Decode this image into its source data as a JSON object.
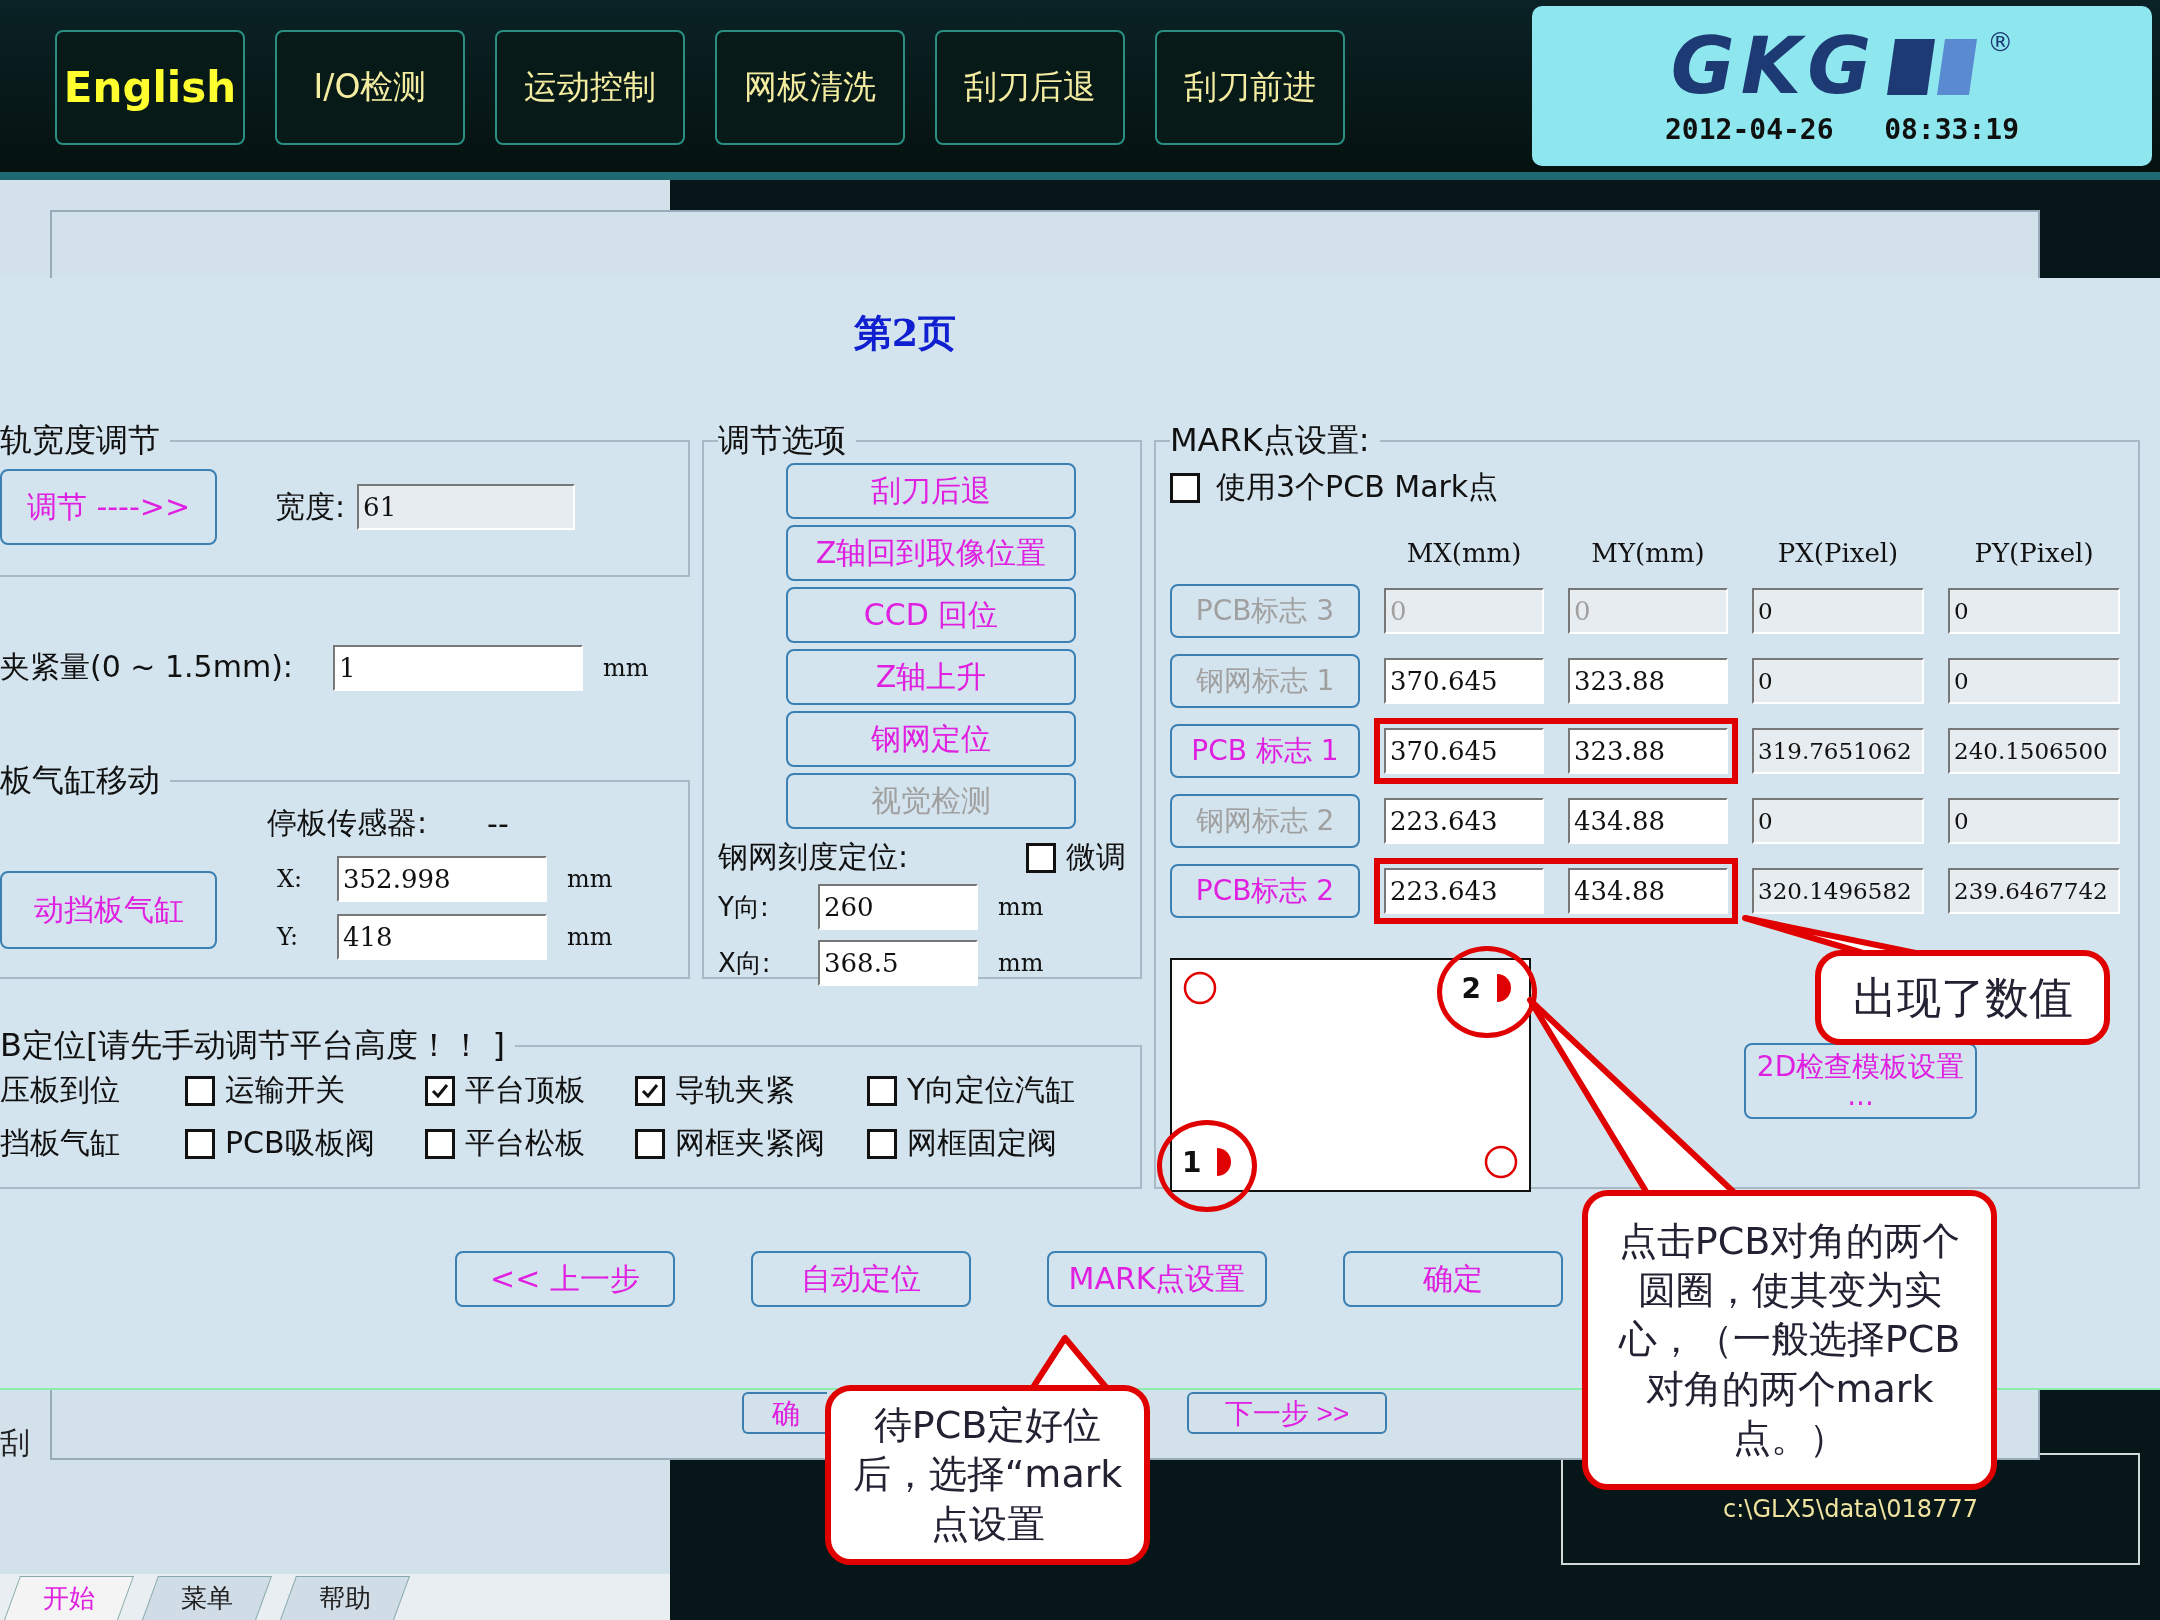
{
  "top_bar": {
    "buttons": [
      {
        "label": "English",
        "kind": "language"
      },
      {
        "label": "I/O检测",
        "kind": "nav"
      },
      {
        "label": "运动控制",
        "kind": "nav"
      },
      {
        "label": "网板清洗",
        "kind": "nav"
      },
      {
        "label": "刮刀后退",
        "kind": "nav"
      },
      {
        "label": "刮刀前进",
        "kind": "nav"
      }
    ]
  },
  "logo": {
    "text": "GKG",
    "registered": "®",
    "datetime": "2012-04-26   08:33:19"
  },
  "background_window": {
    "buttons": [
      "确",
      "下一步 >>"
    ]
  },
  "left_panel": {
    "text": "刮",
    "tabs": [
      {
        "label": "开始",
        "selected": true
      },
      {
        "label": "菜单",
        "selected": false
      },
      {
        "label": "帮助",
        "selected": false
      }
    ]
  },
  "status_path": "c:\\GLX5\\data\\018777",
  "dialog": {
    "title": "第2页",
    "rail_width": {
      "legend": "轨宽度调节",
      "button": "调节 ---->>",
      "width_label": "宽度:",
      "width_value": "61"
    },
    "clamp": {
      "label": "夹紧量(0 ~ 1.5mm):",
      "value": "1",
      "unit": "mm"
    },
    "cylinder": {
      "legend": "板气缸移动",
      "button": "动挡板气缸",
      "sensor_label": "停板传感器:",
      "sensor_value": "--",
      "fields": [
        {
          "label": "X:",
          "value": "352.998",
          "unit": "mm"
        },
        {
          "label": "Y:",
          "value": "418",
          "unit": "mm"
        }
      ]
    },
    "options": {
      "legend": "调节选项",
      "buttons": [
        {
          "label": "刮刀后退",
          "disabled": false
        },
        {
          "label": "Z轴回到取像位置",
          "disabled": false
        },
        {
          "label": "CCD 回位",
          "disabled": false
        },
        {
          "label": "Z轴上升",
          "disabled": false
        },
        {
          "label": "钢网定位",
          "disabled": false
        },
        {
          "label": "视觉检测",
          "disabled": true
        }
      ],
      "scale_label": "钢网刻度定位:",
      "fine_tune": {
        "label": "微调",
        "checked": false
      },
      "fields": [
        {
          "label": "Y向:",
          "value": "260",
          "unit": "mm"
        },
        {
          "label": "X向:",
          "value": "368.5",
          "unit": "mm"
        }
      ]
    },
    "positioning": {
      "legend": "B定位[请先手动调节平台高度！！ ]",
      "rows": [
        [
          {
            "kind": "label",
            "label": "压板到位"
          },
          {
            "kind": "checkbox",
            "label": "运输开关",
            "checked": false
          },
          {
            "kind": "checkbox",
            "label": "平台顶板",
            "checked": true
          },
          {
            "kind": "checkbox",
            "label": "导轨夹紧",
            "checked": true
          },
          {
            "kind": "checkbox",
            "label": "Y向定位汽缸",
            "checked": false
          }
        ],
        [
          {
            "kind": "label",
            "label": "挡板气缸"
          },
          {
            "kind": "checkbox",
            "label": "PCB吸板阀",
            "checked": false
          },
          {
            "kind": "checkbox",
            "label": "平台松板",
            "checked": false
          },
          {
            "kind": "checkbox",
            "label": "网框夹紧阀",
            "checked": false
          },
          {
            "kind": "checkbox",
            "label": "网框固定阀",
            "checked": false
          }
        ]
      ]
    },
    "mark": {
      "legend": "MARK点设置:",
      "use_three": {
        "label": "使用3个PCB Mark点",
        "checked": false
      },
      "columns": [
        "MX(mm)",
        "MY(mm)",
        "PX(Pixel)",
        "PY(Pixel)"
      ],
      "rows": [
        {
          "label": "PCB标志 3",
          "active": false,
          "editable": false,
          "highlighted": false,
          "mx": "0",
          "my": "0",
          "px": "0",
          "py": "0"
        },
        {
          "label": "钢网标志 1",
          "active": false,
          "editable": true,
          "highlighted": false,
          "mx": "370.645",
          "my": "323.88",
          "px": "0",
          "py": "0"
        },
        {
          "label": "PCB 标志 1",
          "active": true,
          "editable": true,
          "highlighted": true,
          "mx": "370.645",
          "my": "323.88",
          "px": "319.7651062",
          "py": "240.1506500"
        },
        {
          "label": "钢网标志 2",
          "active": false,
          "editable": true,
          "highlighted": false,
          "mx": "223.643",
          "my": "434.88",
          "px": "0",
          "py": "0"
        },
        {
          "label": "PCB标志 2",
          "active": true,
          "editable": true,
          "highlighted": true,
          "mx": "223.643",
          "my": "434.88",
          "px": "320.1496582",
          "py": "239.6467742"
        }
      ],
      "board": {
        "marks": [
          {
            "filled": false,
            "circled": false
          },
          {
            "filled": true,
            "circled": true,
            "number": "2"
          },
          {
            "filled": true,
            "circled": true,
            "number": "1"
          },
          {
            "filled": false,
            "circled": false
          }
        ]
      },
      "template_button": "2D检查模板设置 ..."
    },
    "buttons": [
      "<< 上一步",
      "自动定位",
      "MARK点设置",
      "确定"
    ]
  },
  "callouts": [
    {
      "text": "出现了数值"
    },
    {
      "text": "点击PCB对角的两个圆圈，使其变为实心，（一般选择PCB对角的两个mark点。）"
    },
    {
      "text": "待PCB定好位后，选择“mark点设置"
    }
  ]
}
